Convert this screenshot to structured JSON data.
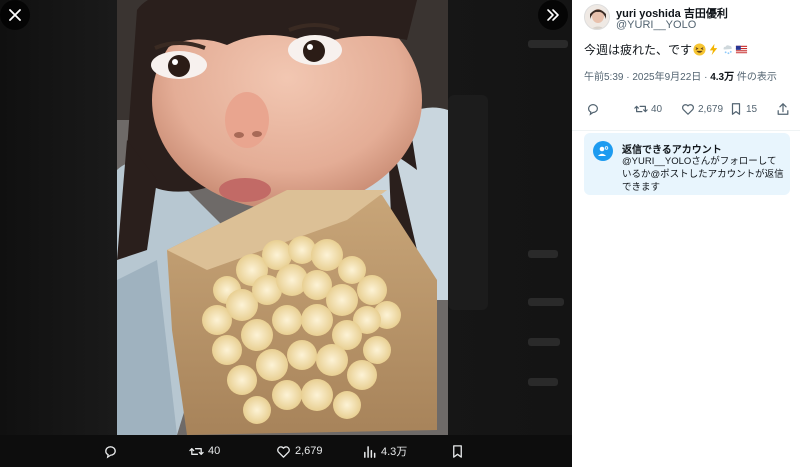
{
  "viewer": {
    "bottom_bar": {
      "replies": "",
      "retweets": "40",
      "likes": "2,679",
      "views": "4.3万"
    }
  },
  "tweet": {
    "display_name": "yuri yoshida 吉田優利",
    "handle": "@YURI__YOLO",
    "text": "今週は疲れた、です",
    "emojis": [
      "grinning-squinting-face",
      "high-voltage",
      "cloud-with-snow",
      "us-flag"
    ],
    "time": "午前5:39",
    "date": "2025年9月22日",
    "views_count": "4.3万",
    "views_label": "件の表示",
    "actions": {
      "replies": "",
      "retweets": "40",
      "likes": "2,679",
      "bookmarks": "15"
    }
  },
  "reply_notice": {
    "title": "返信できるアカウント",
    "body": "@YURI__YOLOさんがフォローしているか@ポストしたアカウントが返信できます"
  },
  "colors": {
    "accent": "#1d9bf0",
    "text_primary": "#0f1419",
    "text_secondary": "#536471",
    "notice_bg": "#e8f5fd",
    "viewer_bg": "#121212"
  }
}
